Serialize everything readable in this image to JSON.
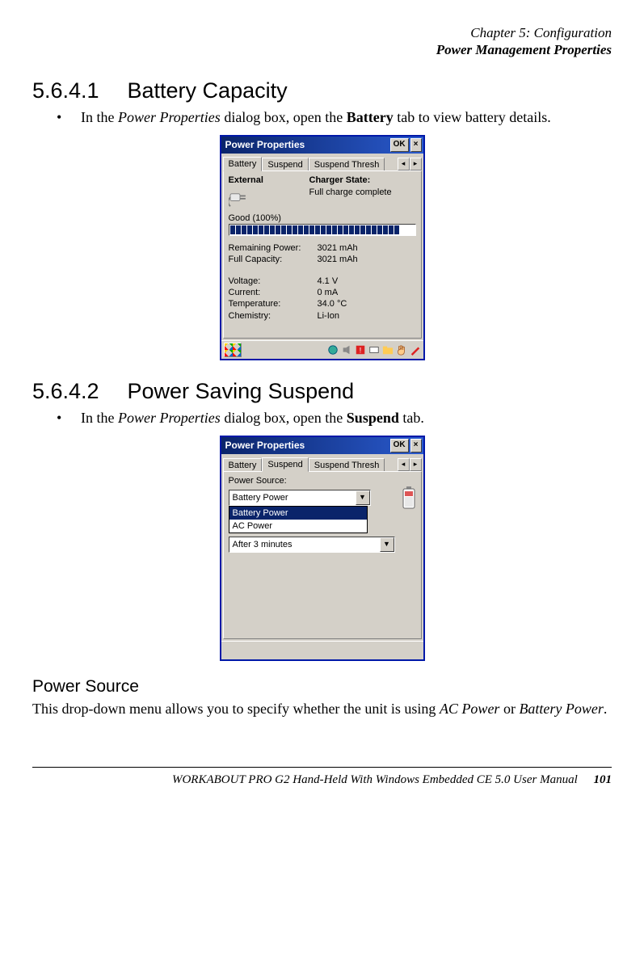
{
  "header": {
    "line1": "Chapter 5: Configuration",
    "line2": "Power Management Properties"
  },
  "s1": {
    "num": "5.6.4.1",
    "title": "Battery Capacity",
    "bullet_pre": "In the ",
    "bullet_ital": "Power Properties",
    "bullet_mid": " dialog box, open the ",
    "bullet_bold": "Battery",
    "bullet_post": " tab to view battery details."
  },
  "dlg1": {
    "title": "Power Properties",
    "ok": "OK",
    "x": "×",
    "tabs": {
      "t1": "Battery",
      "t2": "Suspend",
      "t3": "Suspend Thresh"
    },
    "external": "External",
    "charger_label": "Charger State:",
    "charger_state": "Full charge complete",
    "good": "Good  (100%)",
    "rem_lab": "Remaining Power:",
    "rem_val": "3021 mAh",
    "cap_lab": "Full Capacity:",
    "cap_val": "3021 mAh",
    "volt_lab": "Voltage:",
    "volt_val": "4.1 V",
    "cur_lab": "Current:",
    "cur_val": "0 mA",
    "temp_lab": "Temperature:",
    "temp_val": "34.0 °C",
    "chem_lab": "Chemistry:",
    "chem_val": "Li-Ion"
  },
  "s2": {
    "num": "5.6.4.2",
    "title": "Power Saving Suspend",
    "bullet_pre": "In the ",
    "bullet_ital": "Power Properties",
    "bullet_mid": " dialog box, open the ",
    "bullet_bold": "Suspend",
    "bullet_post": " tab."
  },
  "dlg2": {
    "title": "Power Properties",
    "ok": "OK",
    "x": "×",
    "tabs": {
      "t1": "Battery",
      "t2": "Suspend",
      "t3": "Suspend Thresh"
    },
    "ps_label": "Power Source:",
    "sel": "Battery Power",
    "opt1": "Battery Power",
    "opt2": "AC Power",
    "timeout": "After 3 minutes"
  },
  "s3": {
    "title": "Power Source",
    "body_pre": "This drop-down menu allows you to specify whether the unit is using ",
    "body_i1": "AC Power",
    "body_mid": " or ",
    "body_i2": "Battery Power",
    "body_post": "."
  },
  "footer": {
    "text": "WORKABOUT PRO G2 Hand-Held With Windows Embedded CE 5.0 User Manual",
    "page": "101"
  }
}
